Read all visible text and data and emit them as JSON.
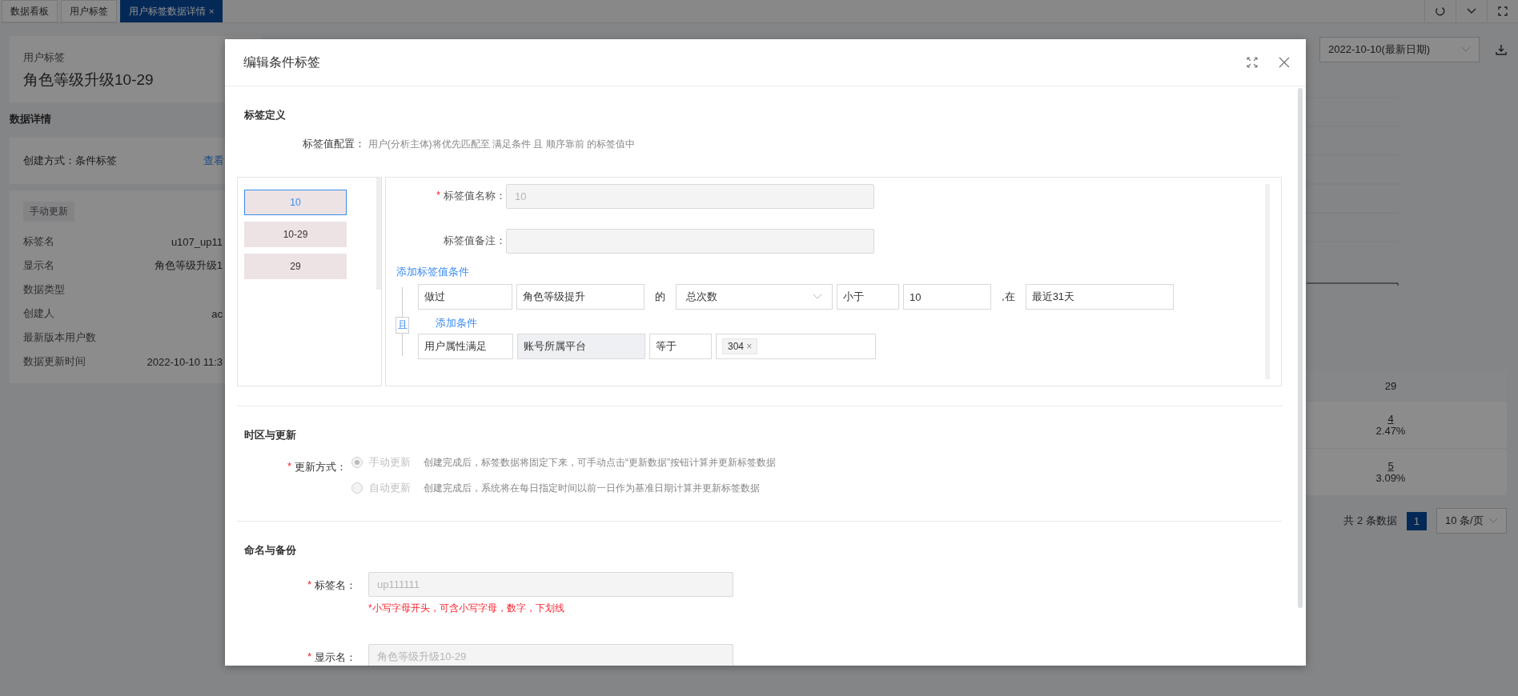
{
  "tabs": [
    {
      "label": "数据看板",
      "selected": false
    },
    {
      "label": "用户标签",
      "selected": false
    },
    {
      "label": "用户标签数据详情",
      "selected": true,
      "close": "×"
    }
  ],
  "tag_card": {
    "caption": "用户标签",
    "title": "角色等级升级10-29"
  },
  "details_heading": "数据详情",
  "creation": {
    "text": "创建方式：条件标签",
    "link": "查看"
  },
  "info": {
    "badge": "手动更新",
    "rows": [
      {
        "label": "标签名",
        "value": "u107_up11"
      },
      {
        "label": "显示名",
        "value": "角色等级升级1"
      },
      {
        "label": "数据类型"
      },
      {
        "label": "创建人",
        "value": "ac"
      },
      {
        "label": "最新版本用户数"
      },
      {
        "label": "数据更新时间",
        "value": "2022-10-10 11:3"
      }
    ]
  },
  "date_select": {
    "value": "2022-10-10(最新日期)"
  },
  "table": {
    "header": "29",
    "rows": [
      {
        "count": "4",
        "percent": "2.47%"
      },
      {
        "count": "5",
        "percent": "3.09%"
      }
    ]
  },
  "pagination": {
    "total": "共 2 条数据",
    "pages": [
      {
        "label": "1",
        "selected": true
      }
    ],
    "page_size": "10 条/页"
  },
  "modal": {
    "title": "编辑条件标签",
    "definition": {
      "heading": "标签定义",
      "config_label": "标签值配置：",
      "config_hint": "用户(分析主体)将优先匹配至 满足条件 且 顺序靠前 的标签值中",
      "values": [
        {
          "label": "10",
          "selected": true
        },
        {
          "label": "10-29",
          "selected": false
        },
        {
          "label": "29",
          "selected": false
        }
      ],
      "name_field": {
        "asterisk": "*",
        "label": "标签值名称：",
        "value": "10"
      },
      "note_field": {
        "label": "标签值备注："
      },
      "add_value_condition": "添加标签值条件",
      "connector": "且",
      "add_condition": "添加条件",
      "conditions": [
        {
          "parts": [
            {
              "kind": "field",
              "text": "做过"
            },
            {
              "kind": "field",
              "text": "角色等级提升"
            },
            {
              "kind": "text",
              "text": "的"
            },
            {
              "kind": "select",
              "text": "总次数"
            },
            {
              "kind": "field",
              "text": "小于"
            },
            {
              "kind": "field",
              "text": "10"
            },
            {
              "kind": "text",
              "text": ",在"
            },
            {
              "kind": "field",
              "text": "最近31天"
            }
          ]
        },
        {
          "parts": [
            {
              "kind": "field",
              "text": "用户属性满足"
            },
            {
              "kind": "readonly",
              "text": "账号所属平台"
            },
            {
              "kind": "field",
              "text": "等于"
            },
            {
              "kind": "tags",
              "tags": [
                {
                  "text": "304",
                  "remove": "×"
                }
              ]
            }
          ]
        }
      ]
    },
    "update": {
      "heading": "时区与更新",
      "asterisk": "*",
      "label": "更新方式：",
      "options": [
        {
          "label": "手动更新",
          "description": "创建完成后，标签数据将固定下来，可手动点击“更新数据”按钮计算并更新标签数据",
          "selected": true,
          "disabled": true
        },
        {
          "label": "自动更新",
          "description": "创建完成后，系统将在每日指定时间以前一日作为基准日期计算并更新标签数据",
          "selected": false,
          "disabled": true
        }
      ]
    },
    "naming": {
      "heading": "命名与备份",
      "fields": [
        {
          "asterisk": "*",
          "label": "标签名：",
          "value": "up111111",
          "error": "*小写字母开头，可含小写字母，数字，下划线"
        },
        {
          "asterisk": "*",
          "label": "显示名：",
          "value": "角色等级升级10-29"
        }
      ]
    }
  }
}
